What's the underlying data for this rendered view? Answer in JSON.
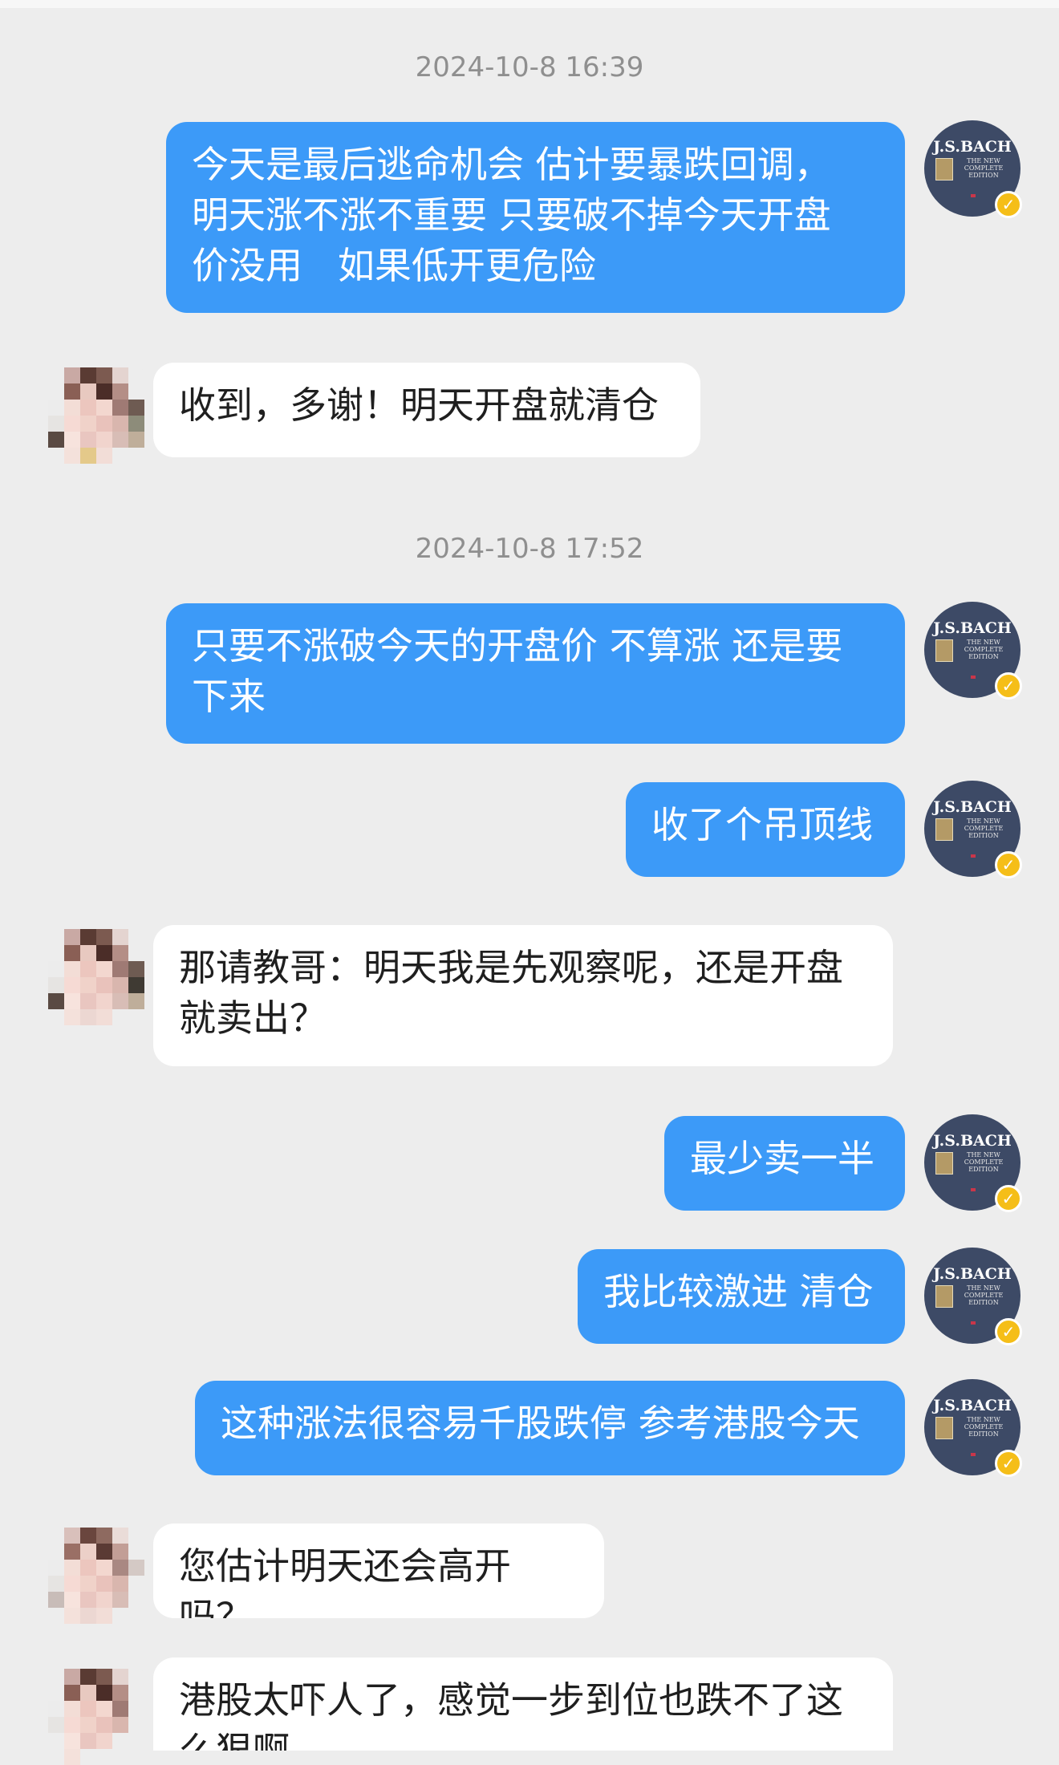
{
  "timestamps": [
    "2024-10-8 16:39",
    "2024-10-8 17:52"
  ],
  "messages": [
    {
      "from": "me",
      "text": "今天是最后逃命机会 估计要暴跌回调，\n明天涨不涨不重要 只要破不掉今天开盘\n价没用   如果低开更危险"
    },
    {
      "from": "other",
      "text": "收到，多谢！明天开盘就清仓"
    },
    {
      "from": "me",
      "text": "只要不涨破今天的开盘价 不算涨 还是要\n下来"
    },
    {
      "from": "me",
      "text": "收了个吊顶线"
    },
    {
      "from": "other",
      "text": "那请教哥：明天我是先观察呢，还是开盘\n就卖出？"
    },
    {
      "from": "me",
      "text": "最少卖一半"
    },
    {
      "from": "me",
      "text": "我比较激进 清仓"
    },
    {
      "from": "me",
      "text": "这种涨法很容易千股跌停 参考港股今天"
    },
    {
      "from": "other",
      "text": "您估计明天还会高开吗？"
    },
    {
      "from": "other",
      "text": "港股太吓人了，感觉一步到位也跌不了这\n么狠啊"
    }
  ],
  "bach_avatar": {
    "title": "J.S.BACH",
    "subtitle": "THE NEW COMPLETE EDITION",
    "background": "#3d4a66",
    "badge_icon": "verified-check-icon",
    "badge_color": "#f5be18"
  },
  "colors": {
    "outgoing_bubble": "#3c9af8",
    "incoming_bubble": "#ffffff",
    "background": "#ededed"
  }
}
